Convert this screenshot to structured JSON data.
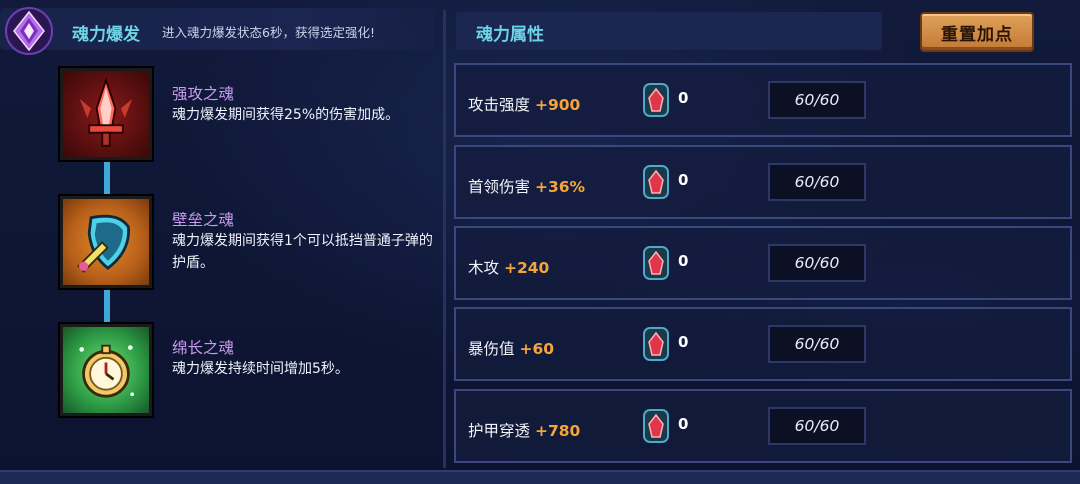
{
  "left": {
    "title": "魂力爆发",
    "description": "进入魂力爆发状态6秒，获得选定强化!",
    "souls": [
      {
        "name": "强攻之魂",
        "desc": "魂力爆发期间获得25%的伤害加成。",
        "color": "#8b1a1a",
        "icon": "red-sword-icon"
      },
      {
        "name": "壁垒之魂",
        "desc": "魂力爆发期间获得1个可以抵挡普通子弹的护盾。",
        "color": "#e48a2a",
        "icon": "shield-icon"
      },
      {
        "name": "绵长之魂",
        "desc": "魂力爆发持续时间增加5秒。",
        "color": "#2d9a44",
        "icon": "pocket-watch-icon"
      }
    ]
  },
  "right": {
    "title": "魂力属性",
    "reset_label": "重置加点",
    "attributes": [
      {
        "label": "攻击强度",
        "bonus": "+900",
        "gems": "0",
        "level": "60/60"
      },
      {
        "label": "首领伤害",
        "bonus": "+36%",
        "gems": "0",
        "level": "60/60"
      },
      {
        "label": "木攻",
        "bonus": "+240",
        "gems": "0",
        "level": "60/60"
      },
      {
        "label": "暴伤值",
        "bonus": "+60",
        "gems": "0",
        "level": "60/60"
      },
      {
        "label": "护甲穿透",
        "bonus": "+780",
        "gems": "0",
        "level": "60/60"
      }
    ]
  },
  "colors": {
    "accent_cyan": "#6fd3e6",
    "soul_name_purple": "#c99bf0",
    "bonus_orange": "#f3a53a",
    "button_orange": "#e0a15a"
  }
}
